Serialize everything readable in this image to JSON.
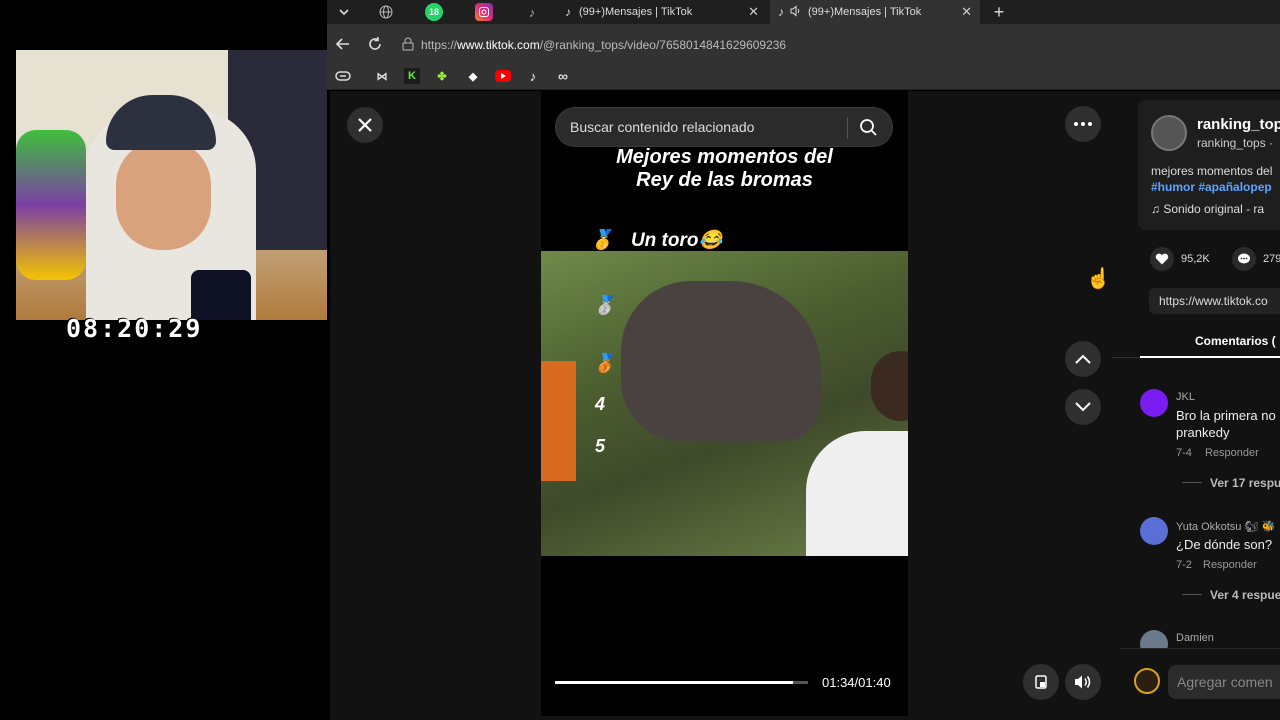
{
  "webcam": {
    "timer": "08:20:29"
  },
  "browser": {
    "tabs": [
      {
        "label": "(99+)Mensajes | TikTok",
        "close": "✕"
      },
      {
        "label": "(99+)Mensajes | TikTok",
        "close": "✕"
      }
    ],
    "tab_icons": {
      "whatsapp_badge": "18"
    },
    "new_tab": "+",
    "url_prefix": "https://",
    "url_host": "www.tiktok.com",
    "url_path": "/@ranking_tops/video/7658014841629609236"
  },
  "video": {
    "search_placeholder": "Buscar contenido relacionado",
    "title_line1": "Mejores momentos del",
    "title_line2": "Rey de las bromas",
    "rank1_text": "Un toro",
    "rank1_medal": "🥇",
    "rank1_emoji": "😂",
    "rank2_medal": "🥈",
    "rank3_medal": "🥉",
    "rank4": "4",
    "rank5": "5",
    "progress": 0.94,
    "time": "01:34/01:40"
  },
  "side": {
    "username": "ranking_top",
    "handle": "ranking_tops ·",
    "description": "mejores momentos del",
    "hashtags": "#humor #apañalopep",
    "sound": "Sonido original - ra",
    "likes": "95,2K",
    "comments_count": "279",
    "link": "https://www.tiktok.co",
    "comments_tab": "Comentarios (",
    "comments": [
      {
        "user": "JKL",
        "text1": "Bro la primera no",
        "text2": "prankedy",
        "date": "7-4",
        "reply": "Responder",
        "more": "Ver 17 respu",
        "color": "#7a1cf2"
      },
      {
        "user": "Yuta Okkotsu 🐿 🐝",
        "text1": "¿De dónde son?",
        "text2": "",
        "date": "7-2",
        "reply": "Responder",
        "more": "Ver 4 respue",
        "color": "#5a6fd6"
      },
      {
        "user": "Damien",
        "text1": "",
        "text2": "",
        "date": "",
        "reply": "",
        "more": "",
        "color": "#6a7a8a"
      }
    ],
    "add_comment": "Agregar comen"
  }
}
